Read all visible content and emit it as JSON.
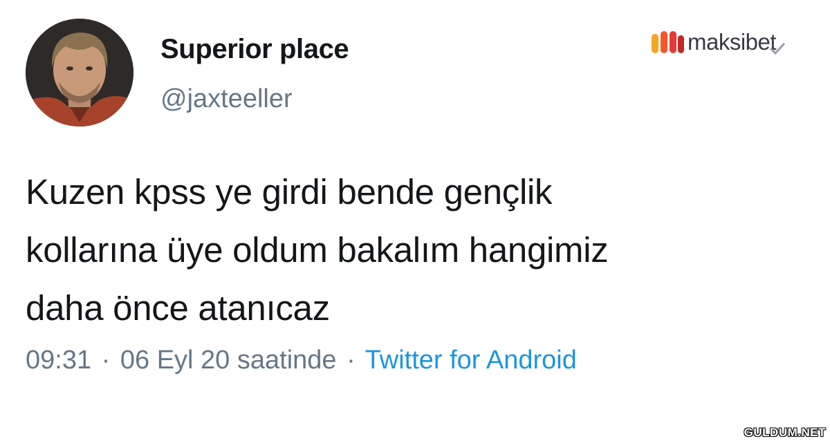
{
  "tweet": {
    "author": {
      "display_name": "Superior place",
      "handle": "@jaxteeller"
    },
    "text": "Kuzen kpss ye girdi bende gençlik\nkollarına üye oldum bakalım hangimiz\ndaha önce atanıcaz",
    "time": "09:31",
    "date": "06 Eyl 20 saatinde",
    "separator": "·",
    "source": "Twitter for Android"
  },
  "brand": {
    "name": "maksibet",
    "accent_color": "#e53935"
  },
  "watermark": {
    "text": "GULDUM.NET"
  },
  "colors": {
    "text_primary": "#14171a",
    "text_secondary": "#657786",
    "link": "#1b95e0"
  }
}
